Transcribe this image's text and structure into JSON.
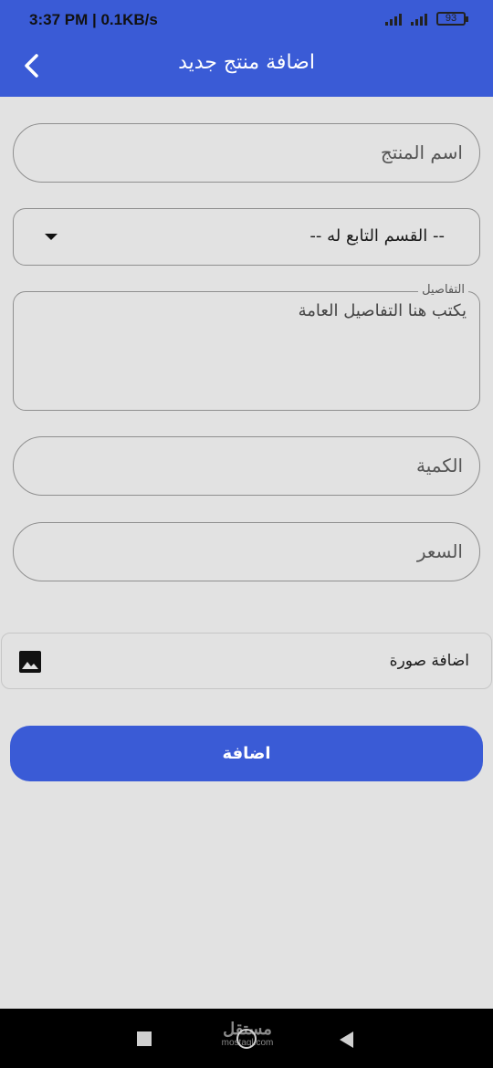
{
  "status_bar": {
    "time": "3:37 PM | 0.1KB/s",
    "battery": "93",
    "icons": [
      "signal-icon",
      "signal-icon",
      "battery-icon"
    ]
  },
  "header": {
    "title": "اضافة منتج جديد",
    "back_icon": "chevron-left-icon"
  },
  "form": {
    "product_name": {
      "placeholder": "اسم المنتج"
    },
    "category": {
      "selected": "-- القسم التابع له --"
    },
    "details": {
      "label": "التفاصيل",
      "placeholder": "يكتب هنا التفاصيل العامة"
    },
    "quantity": {
      "placeholder": "الكمية"
    },
    "price": {
      "placeholder": "السعر"
    },
    "image": {
      "label": "اضافة صورة",
      "icon": "image-icon"
    },
    "submit_label": "اضافة"
  },
  "nav_bar": {
    "watermark_big": "مستقل",
    "watermark_small": "mostaql.com",
    "icons": [
      "recent-apps-icon",
      "home-icon",
      "back-icon"
    ]
  },
  "colors": {
    "primary": "#3a5bd6",
    "background": "#e2e2e2",
    "field_border": "#8f8f8f"
  }
}
